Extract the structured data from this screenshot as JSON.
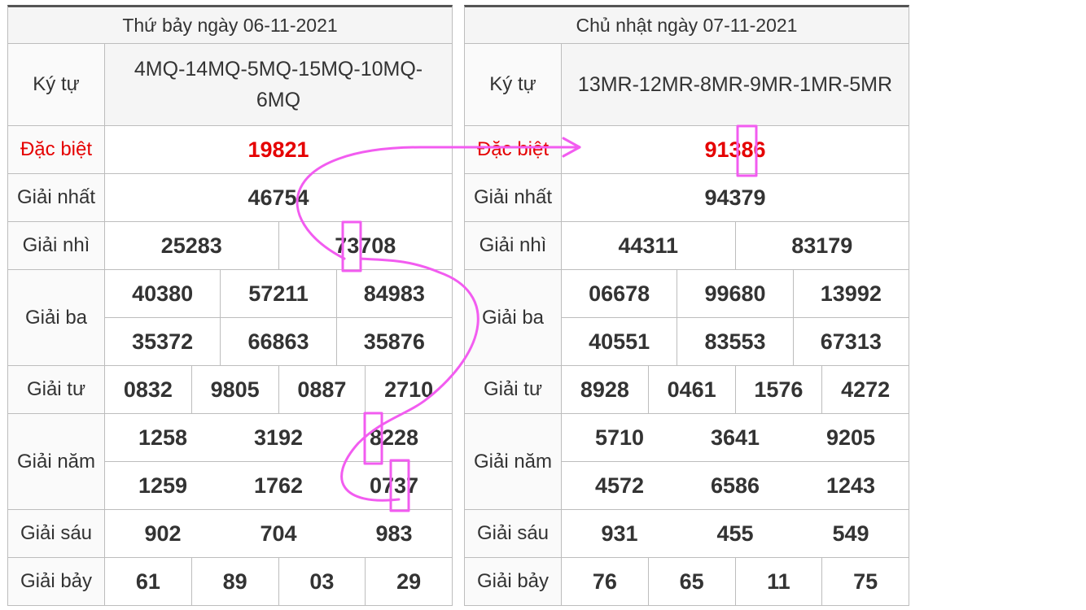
{
  "day1": {
    "header": "Thứ bảy ngày 06-11-2021",
    "code_label": "Ký tự",
    "code": "4MQ-14MQ-5MQ-15MQ-10MQ-6MQ",
    "special_label": "Đặc biệt",
    "special": "19821",
    "first_label": "Giải nhất",
    "first": "46754",
    "second_label": "Giải nhì",
    "second": [
      "25283",
      "73708"
    ],
    "third_label": "Giải ba",
    "third": [
      [
        "40380",
        "57211",
        "84983"
      ],
      [
        "35372",
        "66863",
        "35876"
      ]
    ],
    "fourth_label": "Giải tư",
    "fourth": [
      "0832",
      "9805",
      "0887",
      "2710"
    ],
    "fifth_label": "Giải năm",
    "fifth": [
      [
        "1258",
        "3192",
        "8228"
      ],
      [
        "1259",
        "1762",
        "0737"
      ]
    ],
    "sixth_label": "Giải sáu",
    "sixth": [
      "902",
      "704",
      "983"
    ],
    "seventh_label": "Giải bảy",
    "seventh": [
      "61",
      "89",
      "03",
      "29"
    ]
  },
  "day2": {
    "header": "Chủ nhật ngày 07-11-2021",
    "code_label": "Ký tự",
    "code": "13MR-12MR-8MR-9MR-1MR-5MR",
    "special_label": "Đặc biệt",
    "special": "91386",
    "first_label": "Giải nhất",
    "first": "94379",
    "second_label": "Giải nhì",
    "second": [
      "44311",
      "83179"
    ],
    "third_label": "Giải ba",
    "third": [
      [
        "06678",
        "99680",
        "13992"
      ],
      [
        "40551",
        "83553",
        "67313"
      ]
    ],
    "fourth_label": "Giải tư",
    "fourth": [
      "8928",
      "0461",
      "1576",
      "4272"
    ],
    "fifth_label": "Giải năm",
    "fifth": [
      [
        "5710",
        "3641",
        "9205"
      ],
      [
        "4572",
        "6586",
        "1243"
      ]
    ],
    "sixth_label": "Giải sáu",
    "sixth": [
      "931",
      "455",
      "549"
    ],
    "seventh_label": "Giải bảy",
    "seventh": [
      "76",
      "65",
      "11",
      "75"
    ]
  },
  "annotation_color": "#f25cf0"
}
